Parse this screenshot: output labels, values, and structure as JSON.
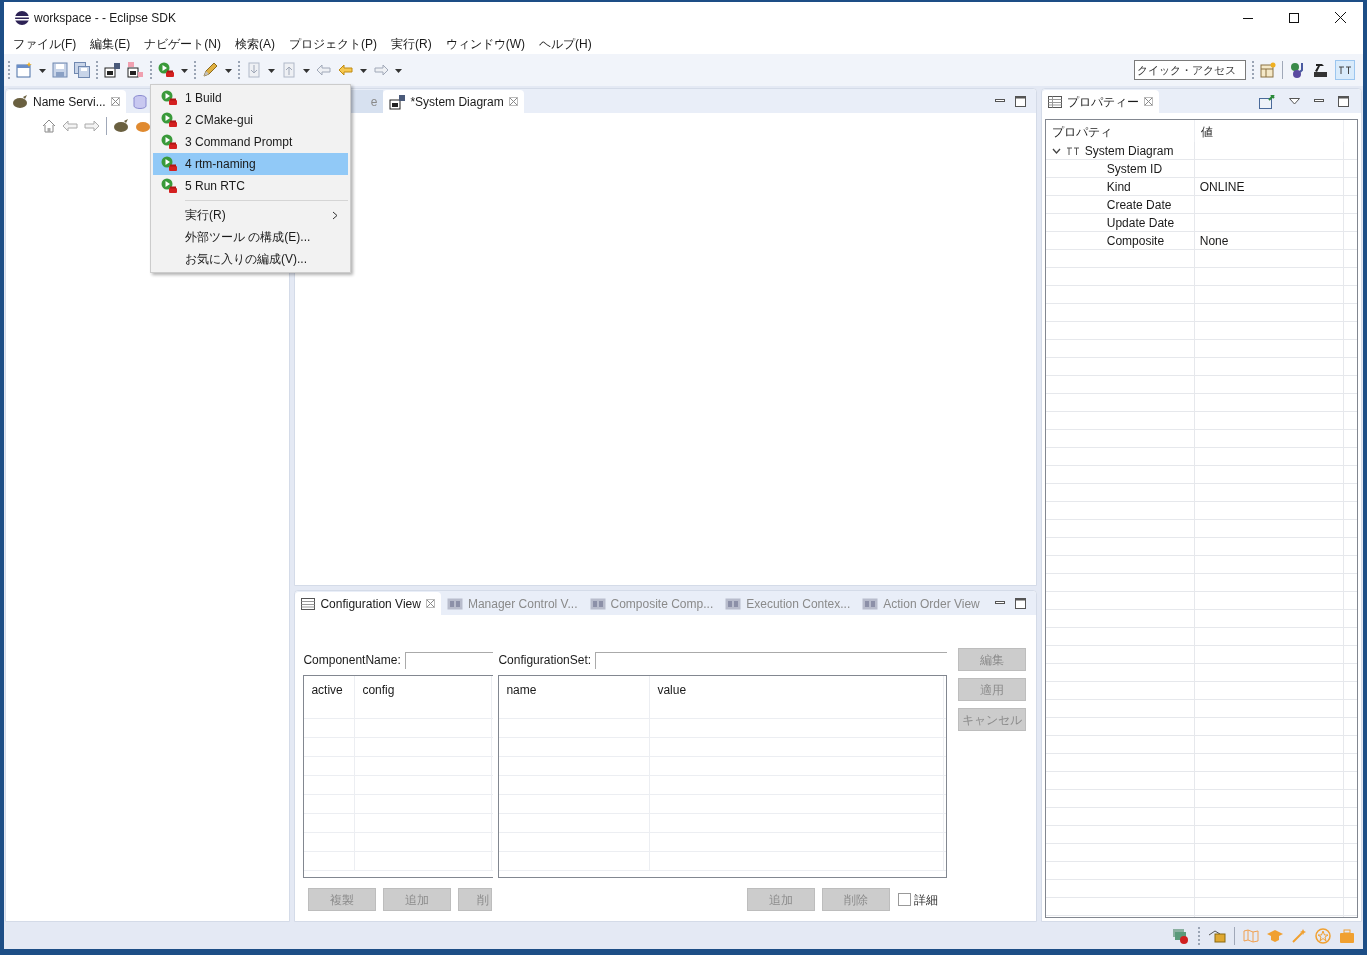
{
  "window": {
    "title": "workspace -  - Eclipse SDK"
  },
  "menu_bar": [
    "ファイル(F)",
    "編集(E)",
    "ナビゲート(N)",
    "検索(A)",
    "プロジェクト(P)",
    "実行(R)",
    "ウィンドウ(W)",
    "ヘルプ(H)"
  ],
  "toolbar": {
    "quick_access": {
      "placeholder": "クイック・アクセス"
    }
  },
  "run_menu": [
    {
      "kind": "launch",
      "label": "1 Build",
      "selected": false
    },
    {
      "kind": "launch",
      "label": "2 CMake-gui",
      "selected": false
    },
    {
      "kind": "launch",
      "label": "3 Command Prompt",
      "selected": false
    },
    {
      "kind": "launch",
      "label": "4 rtm-naming",
      "selected": true
    },
    {
      "kind": "launch",
      "label": "5 Run RTC",
      "selected": false
    },
    {
      "kind": "submenu",
      "label": "実行(R)",
      "selected": false
    },
    {
      "kind": "action",
      "label": "外部ツール の構成(E)...",
      "selected": false
    },
    {
      "kind": "action",
      "label": "お気に入りの編成(V)...",
      "selected": false
    }
  ],
  "left_panel": {
    "tabs": [
      {
        "label": "Name Servi...",
        "selected": true
      }
    ]
  },
  "editor": {
    "tabs": [
      {
        "label": "e",
        "selected": false
      },
      {
        "label": "*System Diagram",
        "selected": true
      }
    ]
  },
  "configuration_view": {
    "tabs": [
      {
        "label": "Configuration View",
        "selected": true
      },
      {
        "label": "Manager Control V...",
        "selected": false
      },
      {
        "label": "Composite Comp...",
        "selected": false
      },
      {
        "label": "Execution Contex...",
        "selected": false
      },
      {
        "label": "Action Order View",
        "selected": false
      }
    ],
    "component_name_label": "ComponentName:",
    "configuration_set_label": "ConfigurationSet:",
    "config_table": {
      "columns": [
        "active",
        "config"
      ]
    },
    "config_buttons": [
      {
        "label": "複製",
        "disabled": true
      },
      {
        "label": "追加",
        "disabled": true
      },
      {
        "label": "削",
        "disabled": true
      }
    ],
    "parameter_table": {
      "columns": [
        "name",
        "value"
      ]
    },
    "parameter_buttons": [
      {
        "label": "追加",
        "disabled": true
      },
      {
        "label": "削除",
        "disabled": true
      }
    ],
    "detail_checkbox": {
      "label": "詳細",
      "checked": false
    },
    "side_buttons": [
      {
        "label": "編集",
        "disabled": true
      },
      {
        "label": "適用",
        "disabled": true
      },
      {
        "label": "キャンセル",
        "disabled": true
      }
    ]
  },
  "properties": {
    "tab": {
      "label": "プロパティー",
      "selected": true
    },
    "columns": [
      "プロパティ",
      "値"
    ],
    "tree": [
      {
        "label": "System Diagram",
        "expanded": true,
        "children": [
          {
            "property": "System ID"
          },
          {
            "property": "Kind",
            "value": "ONLINE"
          },
          {
            "property": "Create Date"
          },
          {
            "property": "Update Date"
          },
          {
            "property": "Composite",
            "value": "None"
          }
        ]
      }
    ]
  }
}
